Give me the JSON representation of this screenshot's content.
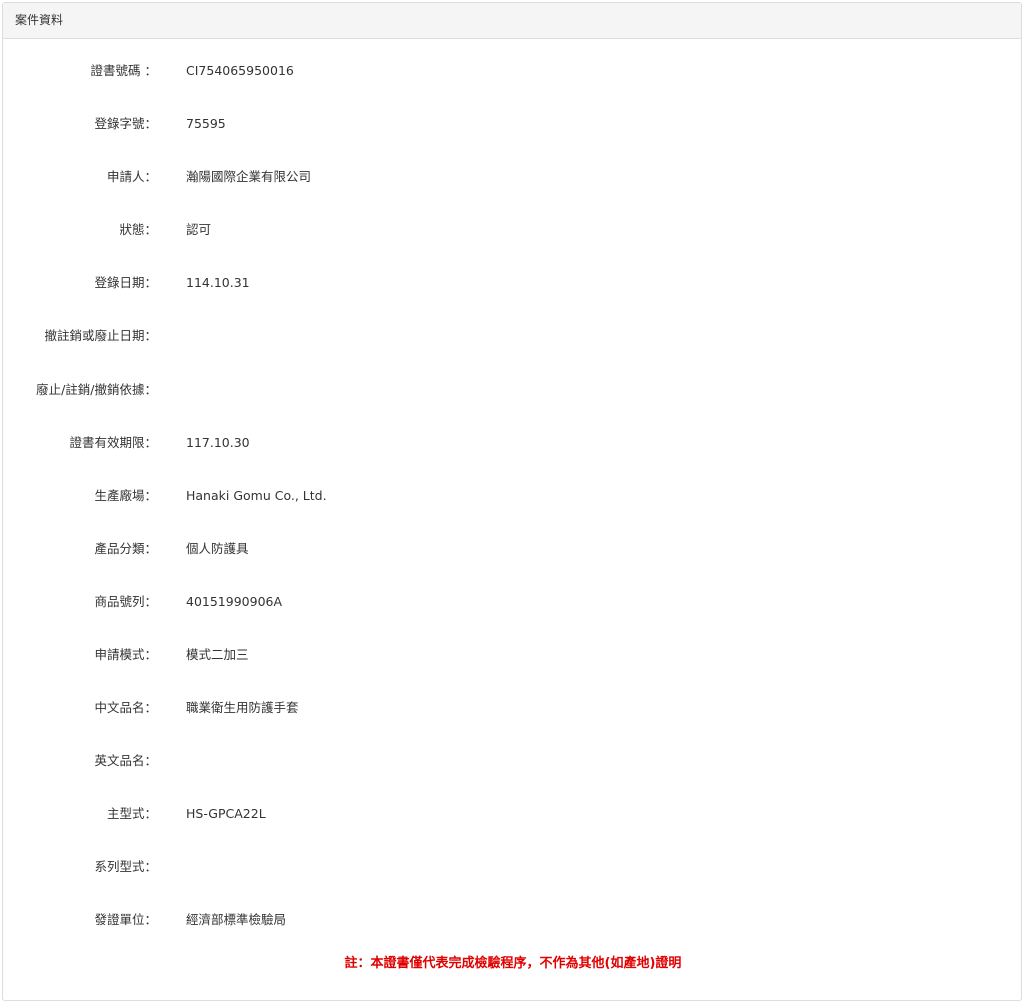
{
  "panel": {
    "title": "案件資料"
  },
  "fields": [
    {
      "label": "證書號碼 ：",
      "value": "CI754065950016"
    },
    {
      "label": "登錄字號：",
      "value": "75595"
    },
    {
      "label": "申請人：",
      "value": "瀚陽國際企業有限公司"
    },
    {
      "label": "狀態：",
      "value": "認可"
    },
    {
      "label": "登錄日期：",
      "value": "114.10.31"
    },
    {
      "label": "撤註銷或廢止日期：",
      "value": ""
    },
    {
      "label": "廢止/註銷/撤銷依據：",
      "value": ""
    },
    {
      "label": "證書有效期限：",
      "value": "117.10.30"
    },
    {
      "label": "生產廠場：",
      "value": "Hanaki Gomu Co., Ltd."
    },
    {
      "label": "產品分類：",
      "value": "個人防護具"
    },
    {
      "label": "商品號列：",
      "value": "40151990906A"
    },
    {
      "label": "申請模式：",
      "value": "模式二加三"
    },
    {
      "label": "中文品名：",
      "value": "職業衛生用防護手套"
    },
    {
      "label": "英文品名：",
      "value": ""
    },
    {
      "label": "主型式：",
      "value": "HS-GPCA22L"
    },
    {
      "label": "系列型式：",
      "value": ""
    },
    {
      "label": "發證單位：",
      "value": "經濟部標準檢驗局"
    }
  ],
  "note": "註：本證書僅代表完成檢驗程序，不作為其他(如產地)證明",
  "colors": {
    "note": "#e00000",
    "heading_bg": "#f5f5f5",
    "border": "#dddddd"
  }
}
